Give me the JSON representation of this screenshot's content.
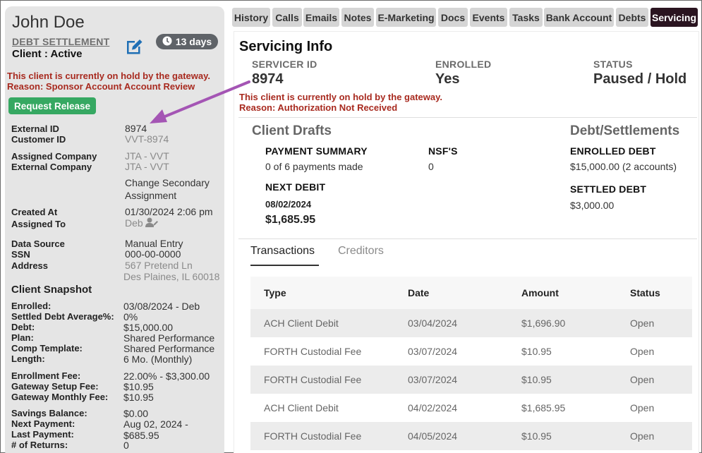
{
  "client": {
    "name": "John Doe",
    "program": "DEBT SETTLEMENT",
    "status": "Client : Active",
    "days_badge": "13 days",
    "hold_message_line1": "This client is currently on hold by the gateway.",
    "hold_message_line2": "Reason: Sponsor Account Account Review",
    "release_button": "Request Release"
  },
  "details": [
    {
      "label": "External ID",
      "value": "8974",
      "muted": false
    },
    {
      "label": "Customer ID",
      "value": "VVT-8974",
      "muted": true
    },
    {
      "label": "Assigned Company",
      "value": "JTA - VVT",
      "muted": true
    },
    {
      "label": "External Company",
      "value": "JTA - VVT",
      "muted": true
    },
    {
      "label": "",
      "value": "Change Secondary",
      "muted": false
    },
    {
      "label": "",
      "value": "Assignment",
      "muted": false
    },
    {
      "label": "Created At",
      "value": "01/30/2024 2:06 pm",
      "muted": false
    },
    {
      "label": "Assigned To",
      "value": "Deb",
      "muted": true
    },
    {
      "label": "Data Source",
      "value": "Manual Entry",
      "muted": false
    },
    {
      "label": "SSN",
      "value": "000-00-0000",
      "muted": false
    },
    {
      "label": "Address",
      "value": "567 Pretend Ln",
      "muted": true
    },
    {
      "label": "",
      "value": "Des Plaines, IL 60018",
      "muted": true
    }
  ],
  "snapshot": {
    "title": "Client Snapshot",
    "rows": [
      {
        "label": "Enrolled:",
        "value": "03/08/2024 - Deb"
      },
      {
        "label": "Settled Debt Average%:",
        "value": "0%"
      },
      {
        "label": "Debt:",
        "value": "$15,000.00"
      },
      {
        "label": "Plan:",
        "value": "Shared Performance"
      },
      {
        "label": "Comp Template:",
        "value": "Shared Performance"
      },
      {
        "label": "Length:",
        "value": "6 Mo. (Monthly)"
      },
      {
        "label": "Enrollment Fee:",
        "value": "22.00% - $3,300.00"
      },
      {
        "label": "Gateway Setup Fee:",
        "value": "$10.95"
      },
      {
        "label": "Gateway Monthly Fee:",
        "value": "$10.95"
      },
      {
        "label": "Savings Balance:",
        "value": "$0.00"
      },
      {
        "label": "Next Payment:",
        "value": "Aug 02, 2024 - $685.95"
      },
      {
        "label": "Last Payment:",
        "value": ""
      },
      {
        "label": "# of Returns:",
        "value": "0"
      }
    ]
  },
  "tabs": [
    {
      "label": "History",
      "active": false
    },
    {
      "label": "Calls",
      "active": false
    },
    {
      "label": "Emails",
      "active": false
    },
    {
      "label": "Notes",
      "active": false
    },
    {
      "label": "E-Marketing",
      "active": false
    },
    {
      "label": "Docs",
      "active": false
    },
    {
      "label": "Events",
      "active": false
    },
    {
      "label": "Tasks",
      "active": false
    },
    {
      "label": "Bank Account",
      "active": false
    },
    {
      "label": "Debts",
      "active": false
    },
    {
      "label": "Servicing",
      "active": true
    }
  ],
  "servicing": {
    "title": "Servicing Info",
    "servicer_id_label": "SERVICER ID",
    "servicer_id": "8974",
    "enrolled_label": "ENROLLED",
    "enrolled": "Yes",
    "status_label": "STATUS",
    "status": "Paused / Hold",
    "hold_line1": "This client is currently on hold by the gateway.",
    "hold_line2": "Reason: Authorization Not Received"
  },
  "drafts": {
    "title": "Client Drafts",
    "payment_summary_label": "PAYMENT SUMMARY",
    "payment_summary": "0 of 6 payments made",
    "nsf_label": "NSF'S",
    "nsf": "0",
    "next_debit_label": "NEXT DEBIT",
    "next_debit_date": "08/02/2024",
    "next_debit_amount": "$1,685.95"
  },
  "debts": {
    "title": "Debt/Settlements",
    "enrolled_label": "ENROLLED DEBT",
    "enrolled": "$15,000.00 (2 accounts)",
    "settled_label": "SETTLED DEBT",
    "settled": "$3,000.00"
  },
  "inner_tabs": {
    "transactions": "Transactions",
    "creditors": "Creditors"
  },
  "transactions": {
    "headers": [
      "Type",
      "Date",
      "Amount",
      "Status"
    ],
    "rows": [
      [
        "ACH Client Debit",
        "03/04/2024",
        "$1,696.90",
        "Open"
      ],
      [
        "FORTH Custodial Fee",
        "03/07/2024",
        "$10.95",
        "Open"
      ],
      [
        "FORTH Custodial Fee",
        "03/07/2024",
        "$10.95",
        "Open"
      ],
      [
        "ACH Client Debit",
        "04/02/2024",
        "$1,685.95",
        "Open"
      ],
      [
        "FORTH Custodial Fee",
        "04/05/2024",
        "$10.95",
        "Open"
      ]
    ]
  },
  "colors": {
    "active_tab": "#2a1420",
    "hold_text": "#a82a1f",
    "release_button": "#36a862",
    "annotation_arrow": "#a455b4"
  },
  "icons": {
    "edit": "edit-icon",
    "clock": "clock-icon",
    "user": "user-edit-icon",
    "annotation": "arrow-annotation"
  }
}
